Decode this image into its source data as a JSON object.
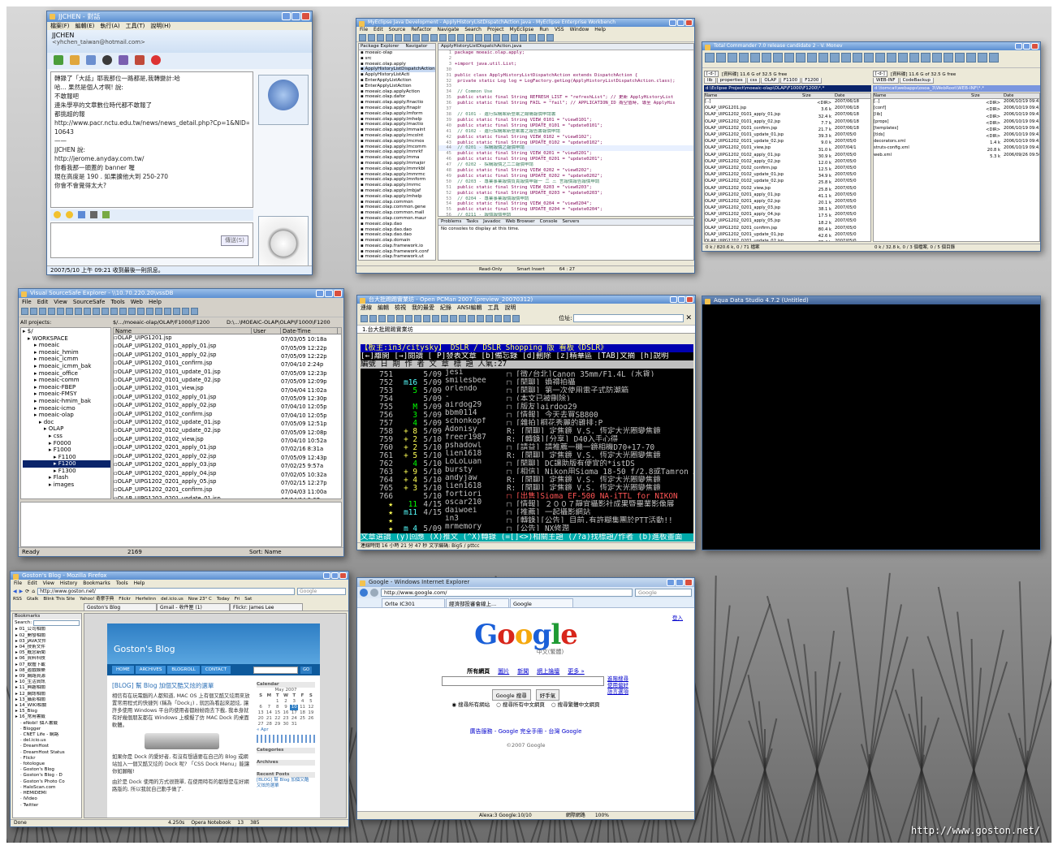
{
  "watermark": "http://www.goston.net/",
  "msn": {
    "title": "JJCHEN - 對話",
    "menu": [
      "檔案(F)",
      "編輯(E)",
      "執行(A)",
      "工具(T)",
      "說明(H)"
    ],
    "contact_name": "JJCHEN",
    "contact_email": "<yhchen_taiwan@hotmail.com>",
    "messages": [
      "轉錄了「大話」耶我那位一路都是,我轉變計:哈",
      "哈... 果然是個人才啊! 說:",
      "  不敢報吧",
      "  連朱學亭的文章數位時代都不敢報了",
      "  都挑超的報",
      "  http://www.pacr.nctu.edu.tw/news/news_detail.php?Cp=1&NID=",
      "  10643",
      "  ——",
      "JJCHEN 說:",
      "  http://jerome.anyday.com.tw/",
      "  你看我那一頭蓋的 banner 喔",
      "  現在高度是 190 . 如果擴他大到 250-270",
      "  你會不會覺得太大?"
    ],
    "send_button": "傳送(S)",
    "status": "2007/5/10 上午 09:21 收到最後一則訊息。"
  },
  "eclipse": {
    "title": "MyEclipse Java Development - ApplyHistoryListDispatchAction.java - MyEclipse Enterprise Workbench",
    "menu": [
      "File",
      "Edit",
      "Source",
      "Refactor",
      "Navigate",
      "Search",
      "Project",
      "MyEclipse",
      "Run",
      "VSS",
      "Window",
      "Help"
    ],
    "perspective": "MyEclipse...",
    "explorer_tabs": [
      "Package Explorer",
      "Navigator"
    ],
    "editor_tab": "ApplyHistoryListDispatchAction.java",
    "tree": [
      "moeaic-olap",
      "src",
      "moeaic.olap.apply",
      "ApplyHistoryListDispatchAction.java",
      "ApplyHistoryListActi",
      "EnterApplyListAction",
      "EnterApplyListAction",
      "moeaic.olap.applyAction",
      "moeaic.olap.dafor",
      "moeaic.olap.apply.finactio",
      "moeaic.olap.apply.finaplr",
      "moeaic.olap.apply.lmform",
      "moeaic.olap.apply.lmhelp",
      "moeaic.olap.apply.lmactio",
      "moeaic.olap.apply.lmmaint",
      "moeaic.olap.apply.lmcolnt",
      "moeaic.olap.apply.lmcmos",
      "moeaic.olap.apply.lmcomm",
      "moeaic.olap.apply.lmmrkf",
      "moeaic.olap.apply.lmma",
      "moeaic.olap.apply.lmmajor",
      "moeaic.olap.apply.lmmrkbl",
      "moeaic.olap.apply.lmmrmc",
      "moeaic.olap.apply.lmnform",
      "moeaic.olap.apply.lmrmc",
      "moeaic.olap.apply.lmbjaf",
      "moeaic.olap.apply.lmhelp",
      "moeaic.olap.common",
      "moeaic.olap.common.gene",
      "moeaic.olap.common.mall",
      "moeaic.olap.common.maur",
      "moeaic.olap.dao",
      "moeaic.olap.dao.dao",
      "moeaic.olap.dao.dao",
      "moeaic.olap.domain",
      "moeaic.olap.framework.io",
      "moeaic.olap.framework.conf",
      "moeaic.olap.framework.ut"
    ],
    "code_lines": [
      [
        "1",
        "package moeaic.olap.apply;"
      ],
      [
        "2",
        ""
      ],
      [
        "3",
        "+import java.util.List;"
      ],
      [
        "30",
        ""
      ],
      [
        "31",
        "public class ApplyHistoryListDispatchAction extends DispatchAction {"
      ],
      [
        "32",
        "    private static Log log = LogFactory.getLog(ApplyHistoryListDispatchAction.class);"
      ],
      [
        "33",
        ""
      ],
      [
        "34",
        "    // Common Use"
      ],
      [
        "35",
        "    public static final String REFRESH_LIST = \"refreshList\"; // 更新 ApplyHistoryList"
      ],
      [
        "36",
        "    public static final String FAIL = \"fail\"; // APPLICATION_ID 為空值時, 導至 ApplyHis"
      ],
      [
        "37",
        ""
      ],
      [
        "38",
        "    // 0101 - 進行採購案新登案之線購報價申請書"
      ],
      [
        "39",
        "    public static final String VIEW_0101 = \"view0101\";"
      ],
      [
        "40",
        "    public static final String UPDATE_0101 = \"update0101\";"
      ],
      [
        "41",
        "    // 0102 - 進行採購案新登案書之報告書報價申請"
      ],
      [
        "42",
        "    public static final String VIEW_0102 = \"view0102\";"
      ],
      [
        "43",
        "    public static final String UPDATE_0102 = \"update0102\";"
      ],
      [
        "44",
        "    // 0201 - 採購報價之報價申請"
      ],
      [
        "45",
        "    public static final String VIEW_0201 = \"view0201\";"
      ],
      [
        "46",
        "    public static final String UPDATE_0201 = \"update0201\";"
      ],
      [
        "47",
        "    // 0202 - 採購報價之二二報價申請"
      ],
      [
        "48",
        "    public static final String VIEW_0202 = \"view0202\";"
      ],
      [
        "49",
        "    public static final String UPDATE_0202 = \"update0202\";"
      ],
      [
        "50",
        "    // 0203 - 專業事業報價負責報價申報一 二 三 言報價報告報價申請"
      ],
      [
        "51",
        "    public static final String VIEW_0203 = \"view0203\";"
      ],
      [
        "52",
        "    public static final String UPDATE_0203 = \"update0203\";"
      ],
      [
        "53",
        "    // 0204 - 專業事業報價報價申請"
      ],
      [
        "54",
        "    public static final String VIEW_0204 = \"view0204\";"
      ],
      [
        "55",
        "    public static final String UPDATE_0204 = \"update0204\";"
      ],
      [
        "56",
        "    // 0211 - 報價報價申請"
      ]
    ],
    "console_tabs": [
      "Problems",
      "Tasks",
      "Javadoc",
      "Web Browser",
      "Console",
      "Servers"
    ],
    "console_text": "No consoles to display at this time.",
    "status": [
      "Read-Only",
      "Smart Insert",
      "64 : 27"
    ]
  },
  "tc": {
    "title": "Total Commander 7.0 release candidate 2 - V. Monev",
    "drive_left": "[-d-]",
    "drive_info_left": "[資料碟]  11.6 G of 32.5 G free",
    "drive_right": "[-d-]",
    "drive_info_right": "[資料碟]  11.6 G of 32.5 G free",
    "tabs_left": [
      "lib",
      "properties",
      "css",
      "OLAP",
      "F1100",
      "F1200"
    ],
    "tabs_right": [
      "WEB-INF",
      "CodeBackup"
    ],
    "path_left": "d:\\Eclipse Project\\moeaic-olap\\OLAP\\F1000\\F1200\\*.*",
    "path_right": "d:\\tomcat\\webapps\\osoa_3\\WebRoot\\WEB-INF\\*.*",
    "cols": [
      "Name",
      "Ext",
      "Size",
      "Date"
    ],
    "files_left": [
      [
        "[..]",
        "",
        "<DIR>",
        "2007/06/18"
      ],
      [
        "OLAP_UIPG1201.jsp",
        "",
        "3.6 k",
        "2007/06/18"
      ],
      [
        "OLAP_UIPG1202_0101_apply_01.jsp",
        "",
        "32.4 k",
        "2007/06/18"
      ],
      [
        "OLAP_UIPG1202_0101_apply_02.jsp",
        "",
        "7.7 k",
        "2007/06/18"
      ],
      [
        "OLAP_UIPG1202_0101_confirm.jsp",
        "",
        "21.7 k",
        "2007/06/18"
      ],
      [
        "OLAP_UIPG1202_0101_update_01.jsp",
        "",
        "39.3 k",
        "2007/05/0"
      ],
      [
        "OLAP_UIPG1202_0101_update_02.jsp",
        "",
        "9.0 k",
        "2007/05/0"
      ],
      [
        "OLAP_UIPG1202_0101_view.jsp",
        "",
        "31.0 k",
        "2007/04/1"
      ],
      [
        "OLAP_UIPG1202_0102_apply_01.jsp",
        "",
        "30.9 k",
        "2007/05/0"
      ],
      [
        "OLAP_UIPG1202_0102_apply_02.jsp",
        "",
        "12.0 k",
        "2007/05/0"
      ],
      [
        "OLAP_UIPG1202_0102_confirm.jsp",
        "",
        "12.5 k",
        "2007/05/0"
      ],
      [
        "OLAP_UIPG1202_0102_update_01.jsp",
        "",
        "34.9 k",
        "2007/05/0"
      ],
      [
        "OLAP_UIPG1202_0102_update_02.jsp",
        "",
        "25.8 k",
        "2007/05/0"
      ],
      [
        "OLAP_UIPG1202_0102_view.jsp",
        "",
        "25.8 k",
        "2007/05/0"
      ],
      [
        "OLAP_UIPG1202_0201_apply_01.jsp",
        "",
        "41.1 k",
        "2007/05/0"
      ],
      [
        "OLAP_UIPG1202_0201_apply_02.jsp",
        "",
        "20.1 k",
        "2007/05/0"
      ],
      [
        "OLAP_UIPG1202_0201_apply_03.jsp",
        "",
        "38.1 k",
        "2007/05/0"
      ],
      [
        "OLAP_UIPG1202_0201_apply_04.jsp",
        "",
        "17.5 k",
        "2007/05/0"
      ],
      [
        "OLAP_UIPG1202_0201_apply_05.jsp",
        "",
        "18.2 k",
        "2007/05/0"
      ],
      [
        "OLAP_UIPG1202_0201_confirm.jsp",
        "",
        "80.4 k",
        "2007/05/0"
      ],
      [
        "OLAP_UIPG1202_0201_update_01.jsp",
        "",
        "42.6 k",
        "2007/05/0"
      ],
      [
        "OLAP_UIPG1202_0201_update_02.jsp",
        "",
        "35.4 k",
        "2007/05/0"
      ],
      [
        "OLAP_UIPG1202_0201_update_03.jsp",
        "",
        "35.4 k",
        "2007/05/0"
      ],
      [
        "OLAP_UIPG1202_0201_update_04.jsp",
        "",
        "17.5 k",
        "2007/05/0"
      ],
      [
        "OLAP_UIPG1202_0201_update_05.jsp",
        "",
        "18.7 k",
        "2007/05/0"
      ],
      [
        "OLAP_UIPG1202_0201_view.jsp",
        "",
        "57.7 k",
        "2007/05/0"
      ],
      [
        "OLAP_UIPG1202_apply.jsp",
        "",
        "12.7 k",
        "2007/05/0"
      ],
      [
        "OLAP_UIPG1202_view.jsp",
        "",
        "8.4 k",
        "2007/05/0"
      ]
    ],
    "files_right": [
      [
        "[..]",
        "",
        "<DIR>",
        "2006/10/19 09:43"
      ],
      [
        "[conf]",
        "",
        "<DIR>",
        "2006/10/19 09:43"
      ],
      [
        "[lib]",
        "",
        "<DIR>",
        "2006/10/19 09:43"
      ],
      [
        "[props]",
        "",
        "<DIR>",
        "2006/10/19 09:43"
      ],
      [
        "[templates]",
        "",
        "<DIR>",
        "2006/10/19 09:43"
      ],
      [
        "[tlds]",
        "",
        "<DIR>",
        "2006/10/19 09:43"
      ],
      [
        "decorators.xml",
        "",
        "1.4 k",
        "2006/10/19 09:43"
      ],
      [
        "struts-config.xml",
        "",
        "20.8 k",
        "2006/10/19 09:43"
      ],
      [
        "web.xml",
        "",
        "5.3 k",
        "2006/09/26 09:50"
      ]
    ],
    "status_left": "0 k / 820.6 k, 0 / 71 檔案",
    "status_right": "0 k / 32.8 k, 0 / 3 個檔案, 0 / 5 個目錄"
  },
  "vss": {
    "title": "Visual SourceSafe Explorer - \\\\10.70.220.20\\vssDB",
    "menu": [
      "File",
      "Edit",
      "View",
      "SourceSafe",
      "Tools",
      "Web",
      "Help"
    ],
    "left_label": "All projects:",
    "path": "$/.../moeaic-olap/OLAP/F1000/F1200",
    "working": "D:\\...\\MOEAIC-OLAP\\OLAP\\F1000\\F1200",
    "tree": [
      "$/",
      "WORKSPACE",
      "moeaic",
      "moeaic_hmim",
      "moeaic_icmm",
      "moeaic_icmm_bak",
      "moeaic_office",
      "moeaic-comm",
      "moeaic-FBEP",
      "moeaic-FMSY",
      "moeaic-hmim_bak",
      "moeaic-icmo",
      "moeaic-olap",
      "doc",
      "OLAP",
      "css",
      "F0000",
      "F1000",
      "F1100",
      "F1200",
      "F1300",
      "Flash",
      "images"
    ],
    "cols": [
      "Name",
      "User",
      "Date-Time"
    ],
    "files": [
      [
        "OLAP_UIPG1201.jsp",
        "",
        "07/03/05 10:18a"
      ],
      [
        "OLAP_UIPG1202_0101_apply_01.jsp",
        "",
        "07/05/09 12:22p"
      ],
      [
        "OLAP_UIPG1202_0101_apply_02.jsp",
        "",
        "07/05/09 12:22p"
      ],
      [
        "OLAP_UIPG1202_0101_confirm.jsp",
        "",
        "07/04/10 2:24p"
      ],
      [
        "OLAP_UIPG1202_0101_update_01.jsp",
        "",
        "07/05/09 12:23p"
      ],
      [
        "OLAP_UIPG1202_0101_update_02.jsp",
        "",
        "07/05/09 12:09p"
      ],
      [
        "OLAP_UIPG1202_0101_view.jsp",
        "",
        "07/04/04 11:02a"
      ],
      [
        "OLAP_UIPG1202_0102_apply_01.jsp",
        "",
        "07/05/09 12:30p"
      ],
      [
        "OLAP_UIPG1202_0102_apply_02.jsp",
        "",
        "07/04/10 12:05p"
      ],
      [
        "OLAP_UIPG1202_0102_confirm.jsp",
        "",
        "07/04/10 12:05p"
      ],
      [
        "OLAP_UIPG1202_0102_update_01.jsp",
        "",
        "07/05/09 12:51p"
      ],
      [
        "OLAP_UIPG1202_0102_update_02.jsp",
        "",
        "07/05/09 12:08p"
      ],
      [
        "OLAP_UIPG1202_0102_view.jsp",
        "",
        "07/04/10 10:52a"
      ],
      [
        "OLAP_UIPG1202_0201_apply_01.jsp",
        "",
        "07/02/16 8:31a"
      ],
      [
        "OLAP_UIPG1202_0201_apply_02.jsp",
        "",
        "07/05/09 12:43p"
      ],
      [
        "OLAP_UIPG1202_0201_apply_03.jsp",
        "",
        "07/02/25 9:57a"
      ],
      [
        "OLAP_UIPG1202_0201_apply_04.jsp",
        "",
        "07/02/05 10:32a"
      ],
      [
        "OLAP_UIPG1202_0201_apply_05.jsp",
        "",
        "07/02/15 12:27p"
      ],
      [
        "OLAP_UIPG1202_0201_confirm.jsp",
        "",
        "07/04/03 11:00a"
      ],
      [
        "OLAP_UIPG1202_0201_update_01.jsp",
        "",
        "07/04/04 3:07p"
      ],
      [
        "OLAP_UIPG1202_0201_update_02.jsp",
        "",
        "07/05/09 12:44p"
      ],
      [
        "OLAP_UIPG1202_0201_update_03.jsp",
        "",
        "07/04/04 2:53p"
      ],
      [
        "OLAP_UIPG1202_0201_update_04.jsp",
        "",
        "07/04/04 2:54p"
      ],
      [
        "OLAP_UIPG1202_0201_update_05.jsp",
        "",
        "07/04/04 3:25p"
      ],
      [
        "OLAP_UIPG1202_0201_view.jsp",
        "",
        "07/04/10 12:10p"
      ]
    ],
    "status": [
      "Ready",
      "2169",
      "Sort: Name"
    ]
  },
  "pcman": {
    "title": "台大批踢踢實業坊 - Open PCMan 2007 (preview_20070312)",
    "menu": [
      "連線",
      "編輯",
      "檢視",
      "我的最愛",
      "紀錄",
      "ANSI編輯",
      "工具",
      "說明"
    ],
    "search_label": "位址:",
    "tab": "1.台大批踢踢實業坊",
    "header1": "【板主:in3/citysky】        DSLR / DSLR_Shopping 版        看板《DSLR》",
    "header2": "[←]離開 [→]閱讀 [ P]發表文章 [b]備忘錄 [d]刪除 [z]精華區 [TAB]文摘 [h]說明",
    "header3": "  編號    日 期  作  者       文  章  標  題                      人氣:27",
    "posts": [
      [
        "751",
        "",
        "5/09",
        "jesi",
        "□ [徵/台北]Canon 35mm/F1.4L (水貨)"
      ],
      [
        "752",
        "m16",
        "5/09",
        "smilesbee",
        "□ [閒聊] 婚禮拍攝"
      ],
      [
        "753",
        "5",
        "5/09",
        "orlendo",
        "□ [閒聊] 第一次使用電子式防潮箱"
      ],
      [
        "754",
        "",
        "5/09",
        "-",
        "□ (本文已被刪除)"
      ],
      [
        "755",
        "M",
        "5/09",
        "airdog29",
        "□ [版友]airdog29"
      ],
      [
        "756",
        "3",
        "5/09",
        "bbm0114",
        "□ [情報] 今天去買SB800"
      ],
      [
        "757",
        "4",
        "5/09",
        "schonkopf",
        "□ [雜拍]桐花秀麗的雞排:P"
      ],
      [
        "758",
        "+ 8",
        "5/09",
        "Adonisy",
        "R: [閒聊] 定焦鏡 V.S. 恆定大光圈變焦鏡"
      ],
      [
        "759",
        "+ 2",
        "5/10",
        "freer1987",
        "R: [轉錄][分享] D40入手心得"
      ],
      [
        "760",
        "+ 2",
        "5/10",
        "pshadowl",
        "□ [請益] 請推薦一機一鏡相機D70+17-70"
      ],
      [
        "761",
        "+ 5",
        "5/10",
        "lien1618",
        "R: [閒聊] 定焦鏡 V.S. 恆定大光圈變焦鏡"
      ],
      [
        "762",
        "4",
        "5/10",
        "LoLoLuan",
        "□ [閒聊] DC讓助版有便宜的*istDS"
      ],
      [
        "763",
        "+ 9",
        "5/10",
        "bursty",
        "□ [相信] Nikon用Sigma 18-50 f/2.8或Tamron A16"
      ],
      [
        "764",
        "+ 4",
        "5/10",
        "andyjaw",
        "R: [閒聊] 定焦鏡 V.S. 恆定大光圈變焦鏡"
      ],
      [
        "765",
        "+ 3",
        "5/10",
        "lien1618",
        "R: [閒聊] 定焦鏡 V.S. 恆定大光圈變焦鏡"
      ],
      [
        "766",
        "",
        "5/10",
        "fortiori",
        "□ [出售]Sigma EF-500 NA-iTTL for NIKON"
      ],
      [
        "★",
        "11",
        "4/15",
        "oscar210",
        "□ [情報] ２００７靜宜攝影社成果暨畢業影像展"
      ],
      [
        "★",
        "m11",
        "4/15",
        "daiwoei",
        "□ [推薦] 一起攝影網站"
      ],
      [
        "★",
        "",
        "",
        "in3",
        "□ [轉錄][公告] 目前,有許糊集團於PTT活動!!"
      ],
      [
        "★",
        "m 4",
        "5/09",
        "mrmemory",
        "□ [公告] NX修潤"
      ]
    ],
    "footer": "文章選讀  (y)回應 (X)推文 (^X)轉錄 (=[]<>)相關主題 (/?a)找標題/作者 (b)進板畫面",
    "status": "連線時間 16 小時 21 分 47 秒     文字編碼: Big5 / pttcc"
  },
  "aqua": {
    "title": "Aqua Data Studio 4.7.2 (Untitled)"
  },
  "firefox": {
    "title": "Goston's Blog - Mozilla Firefox",
    "menu": [
      "File",
      "Edit",
      "View",
      "History",
      "Bookmarks",
      "Tools",
      "Help"
    ],
    "url": "http://www.goston.net/",
    "search": "Google",
    "bookmarks_bar": [
      "RSS",
      "Gtalk",
      "Blink This Site",
      "Yahoo! 奇摩字典",
      "Flickr",
      "Herfelinn",
      "del.icio.us",
      "Now 23° C",
      "Today",
      "Fri",
      "Sat"
    ],
    "tabs": [
      "Goston's Blog",
      "Gmail - 收件匣 (1)",
      "Flickr: James Lee"
    ],
    "sidebar_title": "Bookmarks",
    "sidebar_search": "Search:",
    "bookmarks": [
      "01_公司相關",
      "02_開發相關",
      "03_JAVA文件",
      "04_技術文件",
      "05_概念新聞",
      "06_資料科技",
      "07_軟體下載",
      "08_遊戲娛樂",
      "09_網路資源",
      "10_生活資訊",
      "11_興趣相關",
      "12_網誌相關",
      "13_攝影相關",
      "14_WIKI相關",
      "15_Blog",
      "16_常用書籤",
      "eNobi! 個人書籤",
      "Blogger",
      "CNET Life - 網路",
      "del.icio.us",
      "DreamHost",
      "DreamHost Status",
      "Flickr",
      "fotologue",
      "Goston's Blog",
      "Goston's Blog - D",
      "Goston's Photo Co",
      "HaloScan.com",
      "HEMIDEMI",
      "iVideo",
      "Twitter"
    ],
    "blog_title": "Goston's Blog",
    "nav": [
      "HOME",
      "ARCHIVES",
      "BLOGROLL",
      "CONTACT"
    ],
    "go_btn": "GO",
    "post_title": "[BLOG] 幫 Blog 加個又酷又炫的選單",
    "post_body1": "相信有在玩電腦的人都知道, MAC OS 上有個又酷又炫用來放置常用程式的快捷列 (稱為「Dock」) , 就因為看起來超炫, 讓許多使用 Windows 平台的使用者都紛紛跑去下載, 我本身就有好幾個朋友都在 Windows 上模擬了仿 MAC Dock 的桌面軟體。",
    "post_body2": "如果你是 Dock 的愛好者, 有沒有想過要在自己的 Blog 或網站加入一個又酷又炫的 Dock 呢? 「CSS Dock Menu」能讓你如願喔!",
    "post_body3": "由於是 Dock 使用的方式很簡單, 在使用時有的都想是在好網路版的, 所以我就自己動手做了.",
    "calendar_title": "Calendar",
    "calendar_month": "May 2007",
    "calendar_days": [
      "S",
      "M",
      "T",
      "W",
      "T",
      "F",
      "S"
    ],
    "calendar_dates": [
      "",
      "",
      "1",
      "2",
      "3",
      "4",
      "5",
      "6",
      "7",
      "8",
      "9",
      "10",
      "11",
      "12",
      "13",
      "14",
      "15",
      "16",
      "17",
      "18",
      "19",
      "20",
      "21",
      "22",
      "23",
      "24",
      "25",
      "26",
      "27",
      "28",
      "29",
      "30",
      "31",
      "",
      ""
    ],
    "side_apr": "« Apr",
    "side_categories": "Categories",
    "side_archives": "Archives",
    "side_recent": "Recent Posts",
    "side_recent1": "[BLOG] 幫 Blog 加個又酷",
    "side_recent2": "又炫的選單",
    "status": "Done",
    "status_items": [
      "4.250s",
      "Opera Notebook",
      "13",
      "385"
    ]
  },
  "ie": {
    "title": "Google - Windows Internet Explorer",
    "url": "http://www.google.com/",
    "search": "Google",
    "tabs": [
      "Orlte IC301",
      "經濟部投審會線上...",
      "Google"
    ],
    "login": "登入",
    "logo_main": "Google",
    "logo_sub": "中文(繁體)",
    "nav": [
      "所有網頁",
      "圖片",
      "新聞",
      "網上論壇",
      "更多 »"
    ],
    "btn_search": "Google 搜尋",
    "btn_lucky": "好手氣",
    "links_right": [
      "進階搜尋",
      "使用偏好",
      "語言選項"
    ],
    "radios": [
      "搜尋所有網站",
      "搜尋所有中文網頁",
      "搜尋繁體中文網頁"
    ],
    "footer_links": "廣告服務 - Google 完全手冊 - 台灣 Google",
    "copyright": "©2007 Google",
    "status_left": "Alexa:3 Google:10/10",
    "status_zone": "網際網路",
    "zoom": "100%"
  }
}
